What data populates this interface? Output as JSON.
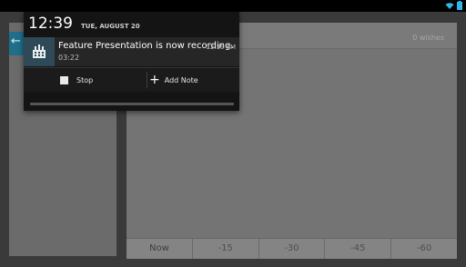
{
  "status_bar": {
    "wifi_icon": "wifi-icon",
    "battery_icon": "battery-icon"
  },
  "notification_shade": {
    "time": "12:39",
    "date": "TUE, AUGUST 20",
    "notification": {
      "icon": "film-board-icon",
      "title": "Feature Presentation is now recording.",
      "timestamp": "12:39 PM",
      "elapsed": "03:22"
    },
    "actions": {
      "stop_label": "Stop",
      "add_note_label": "Add Note"
    }
  },
  "background_app": {
    "wishes_text": "0 wishes",
    "tabs": [
      {
        "label": "Now"
      },
      {
        "label": "-15"
      },
      {
        "label": "-30"
      },
      {
        "label": "-45"
      },
      {
        "label": "-60"
      }
    ]
  }
}
